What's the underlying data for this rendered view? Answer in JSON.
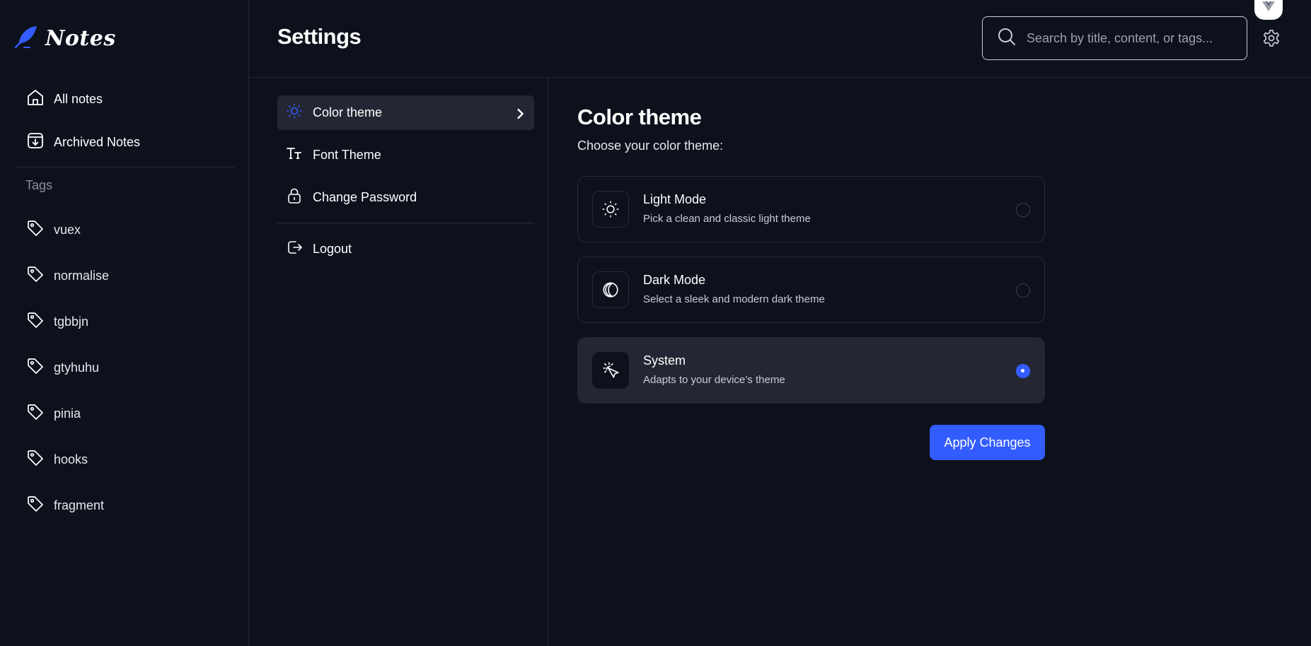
{
  "app": {
    "name": "Notes"
  },
  "sidebar": {
    "nav": [
      {
        "label": "All notes",
        "icon": "home-icon"
      },
      {
        "label": "Archived Notes",
        "icon": "archive-icon"
      }
    ],
    "tags_heading": "Tags",
    "tags": [
      "vuex",
      "normalise",
      "tgbbjn",
      "gtyhuhu",
      "pinia",
      "hooks",
      "fragment"
    ]
  },
  "header": {
    "title": "Settings",
    "search_placeholder": "Search by title, content, or tags..."
  },
  "settings_menu": {
    "items": [
      {
        "label": "Color theme",
        "icon": "sun-icon",
        "active": true
      },
      {
        "label": "Font Theme",
        "icon": "font-icon",
        "active": false
      },
      {
        "label": "Change Password",
        "icon": "lock-icon",
        "active": false
      }
    ],
    "logout_label": "Logout"
  },
  "content": {
    "title": "Color theme",
    "subtitle": "Choose your color theme:",
    "options": [
      {
        "title": "Light Mode",
        "description": "Pick a clean and classic light theme",
        "icon": "sun-icon",
        "selected": false
      },
      {
        "title": "Dark Mode",
        "description": "Select a sleek and modern dark theme",
        "icon": "moon-icon",
        "selected": false
      },
      {
        "title": "System",
        "description": "Adapts to your device’s theme",
        "icon": "system-theme-icon",
        "selected": true
      }
    ],
    "apply_label": "Apply Changes"
  },
  "colors": {
    "accent": "#335cff",
    "background": "#0d111c",
    "selected_bg": "#242733"
  }
}
